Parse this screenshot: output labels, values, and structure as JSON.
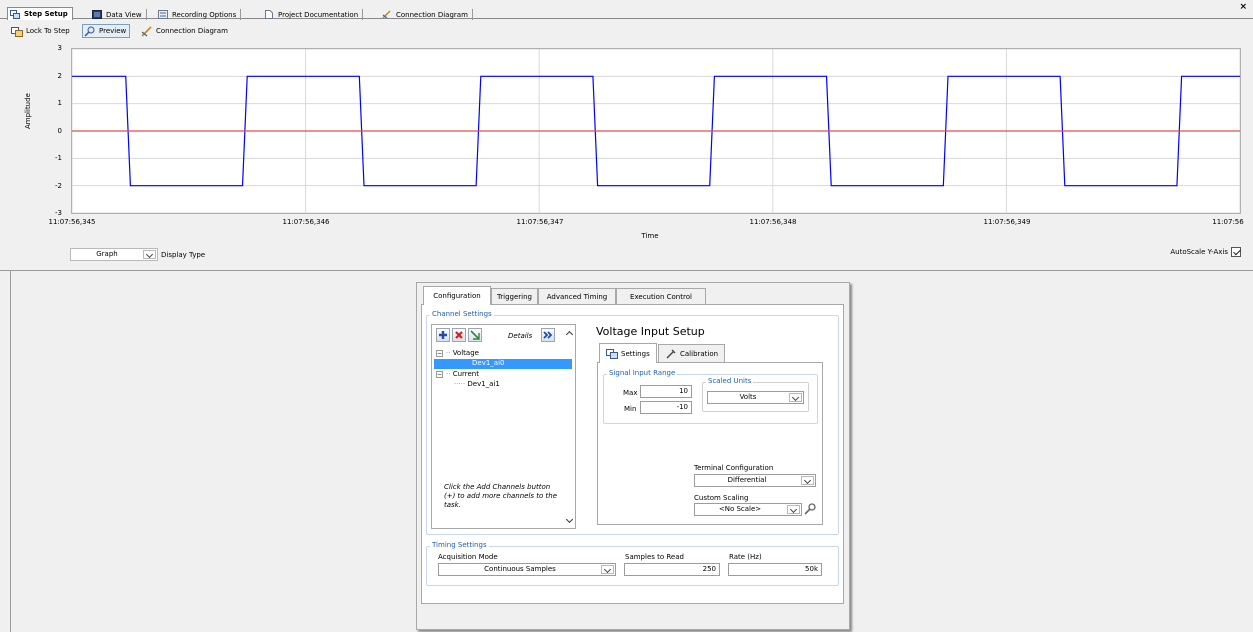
{
  "top_tabs": [
    {
      "label": "Step Setup",
      "icon": "step-setup-icon",
      "active": true
    },
    {
      "label": "Data View",
      "icon": "data-view-icon",
      "active": false
    },
    {
      "label": "Recording Options",
      "icon": "recording-options-icon",
      "active": false
    },
    {
      "label": "Project Documentation",
      "icon": "document-icon",
      "active": false
    },
    {
      "label": "Connection Diagram",
      "icon": "connection-diagram-icon",
      "active": false
    }
  ],
  "close_label": "×",
  "toolbar": {
    "lock_label": "Lock To Step",
    "preview_label": "Preview",
    "connection_label": "Connection Diagram"
  },
  "graph": {
    "display_type_value": "Graph",
    "display_type_label": "Display Type",
    "autoscale_label": "AutoScale Y-Axis",
    "autoscale_checked": true
  },
  "chart_data": {
    "type": "line",
    "xlabel": "Time",
    "ylabel": "Amplitude",
    "ylim": [
      -3,
      3
    ],
    "yticks": [
      "3",
      "2",
      "1",
      "0",
      "-1",
      "-2",
      "-3"
    ],
    "xticks": [
      "11:07:56,345",
      "11:07:56,346",
      "11:07:56,347",
      "11:07:56,348",
      "11:07:56,349",
      "11:07:56"
    ],
    "x_ms_range": [
      0,
      5
    ],
    "grid": true,
    "series": [
      {
        "color": "#0000ff",
        "style": "square-wave",
        "high": 2,
        "low": -2,
        "segments_ms": [
          [
            0,
            0.23,
            2
          ],
          [
            0.25,
            0.73,
            -2
          ],
          [
            0.75,
            1.23,
            2
          ],
          [
            1.25,
            1.73,
            -2
          ],
          [
            1.75,
            2.23,
            2
          ],
          [
            2.25,
            2.73,
            -2
          ],
          [
            2.75,
            3.23,
            2
          ],
          [
            3.25,
            3.73,
            -2
          ],
          [
            3.75,
            4.23,
            2
          ],
          [
            4.25,
            4.73,
            -2
          ],
          [
            4.75,
            5.0,
            2
          ]
        ]
      },
      {
        "color": "#e0504a",
        "style": "flat",
        "values": [
          0,
          0
        ]
      }
    ]
  },
  "config": {
    "tabs": [
      "Configuration",
      "Triggering",
      "Advanced Timing",
      "Execution Control"
    ],
    "active_tab": "Configuration",
    "channel_settings": {
      "title": "Channel Settings",
      "details_label": "Details",
      "tree": [
        {
          "label": "Voltage",
          "level": 0,
          "selected": false
        },
        {
          "label": "Dev1_ai0",
          "level": 1,
          "selected": true
        },
        {
          "label": "Current",
          "level": 0,
          "selected": false
        },
        {
          "label": "Dev1_ai1",
          "level": 1,
          "selected": false
        }
      ],
      "hint": "Click the Add Channels button (+) to add more channels to the task."
    },
    "voltage_setup": {
      "title": "Voltage Input Setup",
      "tabs": [
        "Settings",
        "Calibration"
      ],
      "signal_range_title": "Signal Input Range",
      "max_label": "Max",
      "max_value": "10",
      "min_label": "Min",
      "min_value": "-10",
      "scaled_units_title": "Scaled Units",
      "scaled_units_value": "Volts",
      "terminal_label": "Terminal Configuration",
      "terminal_value": "Differential",
      "custom_scaling_label": "Custom Scaling",
      "custom_scaling_value": "<No Scale>"
    },
    "timing": {
      "title": "Timing Settings",
      "mode_label": "Acquisition Mode",
      "mode_value": "Continuous Samples",
      "samples_label": "Samples to Read",
      "samples_value": "250",
      "rate_label": "Rate (Hz)",
      "rate_value": "50k"
    }
  }
}
